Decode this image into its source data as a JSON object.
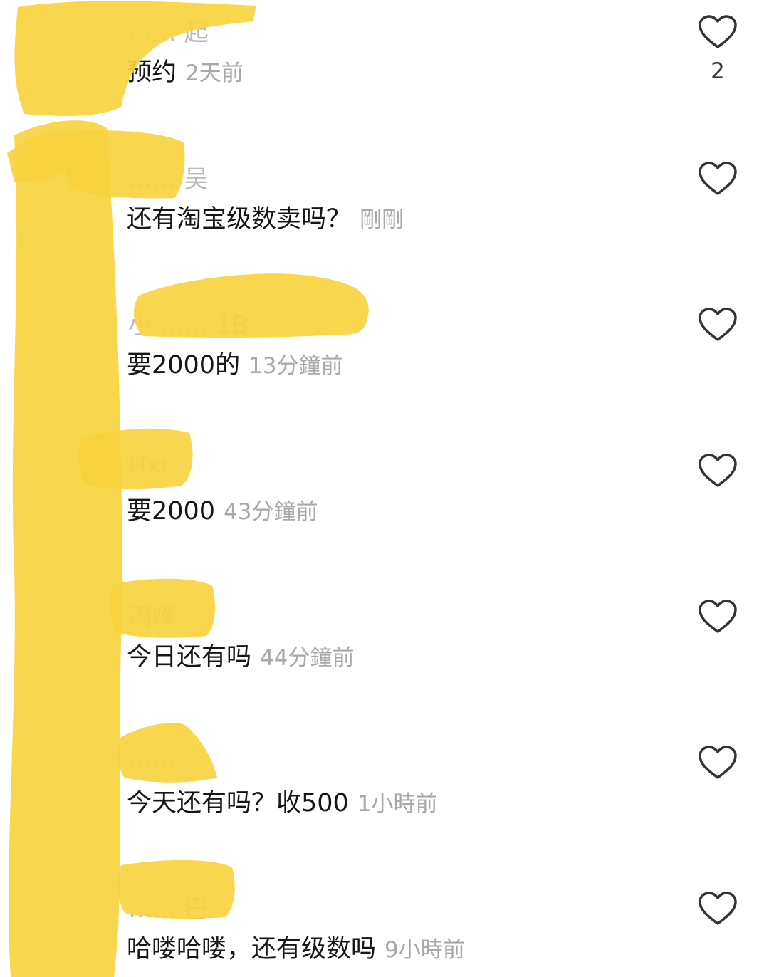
{
  "colors": {
    "background": "#ffffff",
    "content_text": "#161616",
    "meta_text": "#a8a8a8",
    "redaction": "#f7d23e"
  },
  "comments": [
    {
      "username": "…… 起",
      "content": "预约",
      "time": "2天前",
      "likes": "2"
    },
    {
      "username": "…… 吴",
      "content": "还有淘宝级数卖吗？",
      "time": "剛剛",
      "likes": ""
    },
    {
      "username": "小 …… 1B",
      "content": "要2000的",
      "time": "13分鐘前",
      "likes": ""
    },
    {
      "username": "Hxr",
      "content": "要2000",
      "time": "43分鐘前",
      "likes": ""
    },
    {
      "username": "兩嘀",
      "content": "今日还有吗",
      "time": "44分鐘前",
      "likes": ""
    },
    {
      "username": "……",
      "content": "今天还有吗？收500",
      "time": "1小時前",
      "likes": ""
    },
    {
      "username": "…… 巴",
      "content": "哈喽哈喽，还有级数吗",
      "time": "9小時前",
      "likes": ""
    }
  ],
  "icons": {
    "like": "heart-outline-icon"
  }
}
